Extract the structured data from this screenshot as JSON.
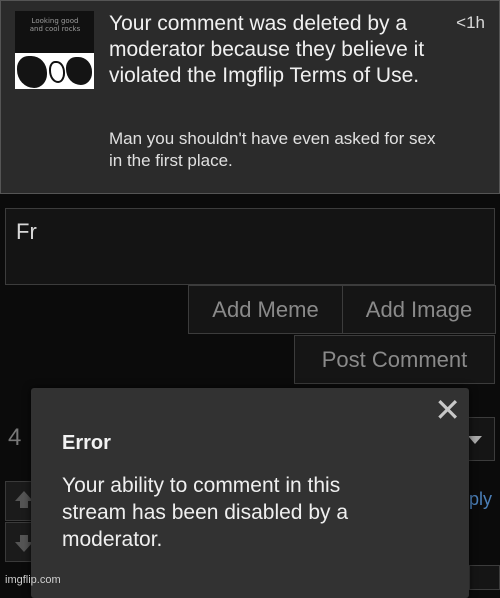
{
  "notification": {
    "title": "Your comment was deleted by a moderator because they believe it violated the Imgflip Terms of Use.",
    "time": "<1h",
    "body": "Man you shouldn't have even asked for sex in the first place.",
    "thumbnail_caption": "Looking good and cool rocks"
  },
  "comment": {
    "input_text": "Fr"
  },
  "buttons": {
    "add_meme": "Add Meme",
    "add_image": "Add Image",
    "post_comment": "Post Comment"
  },
  "background": {
    "vote_count": "4",
    "reply_label": "ply"
  },
  "modal": {
    "title": "Error",
    "message": "Your ability to comment in this stream has been disabled by a moderator.",
    "close_symbol": "✕"
  },
  "watermark": "imgflip.com"
}
